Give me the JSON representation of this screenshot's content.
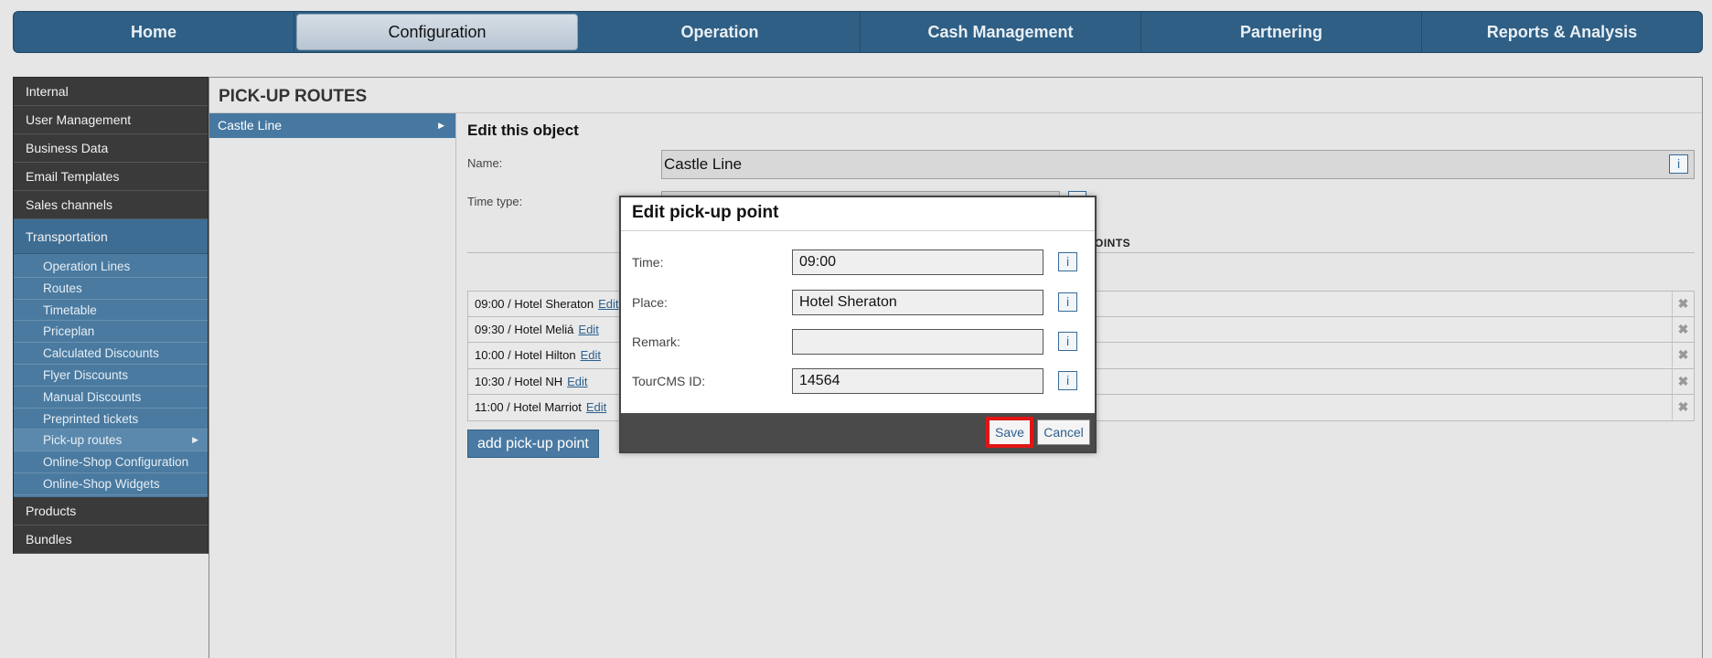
{
  "topnav": {
    "tabs": [
      {
        "label": "Home"
      },
      {
        "label": "Configuration"
      },
      {
        "label": "Operation"
      },
      {
        "label": "Cash Management"
      },
      {
        "label": "Partnering"
      },
      {
        "label": "Reports & Analysis"
      }
    ],
    "active": "Configuration"
  },
  "sidebar": {
    "items_top": [
      "Internal",
      "User Management",
      "Business Data",
      "Email Templates",
      "Sales channels"
    ],
    "transportation": "Transportation",
    "sub_items": [
      "Operation Lines",
      "Routes",
      "Timetable",
      "Priceplan",
      "Calculated Discounts",
      "Flyer Discounts",
      "Manual Discounts",
      "Preprinted tickets",
      "Pick-up routes",
      "Online-Shop Configuration",
      "Online-Shop Widgets"
    ],
    "items_bottom": [
      "Products",
      "Bundles"
    ]
  },
  "main": {
    "title": "PICK-UP ROUTES",
    "selected_route": "Castle Line",
    "edit_title": "Edit this object",
    "name_label": "Name:",
    "name_value": "Castle Line",
    "time_type_label": "Time type:",
    "points_header": "OINTS",
    "points": [
      {
        "text": "09:00 / Hotel Sheraton",
        "edit": "Edit"
      },
      {
        "text": "09:30 / Hotel Meliá",
        "edit": "Edit"
      },
      {
        "text": "10:00 / Hotel Hilton",
        "edit": "Edit"
      },
      {
        "text": "10:30 / Hotel NH",
        "edit": "Edit"
      },
      {
        "text": "11:00 / Hotel Marriot",
        "edit": "Edit"
      }
    ],
    "add_button": "add pick-up point",
    "info_glyph": "i",
    "delete_glyph": "✖"
  },
  "modal": {
    "title": "Edit pick-up point",
    "time_label": "Time:",
    "time_value": "09:00",
    "place_label": "Place:",
    "place_value": "Hotel Sheraton",
    "remark_label": "Remark:",
    "remark_value": "",
    "tourcms_label": "TourCMS ID:",
    "tourcms_value": "14564",
    "save": "Save",
    "cancel": "Cancel"
  },
  "colors": {
    "nav_blue": "#2f5f85",
    "sidebar_dark": "#3a3a3a",
    "selected_blue": "#4778a1",
    "highlight_red": "#e01515"
  }
}
